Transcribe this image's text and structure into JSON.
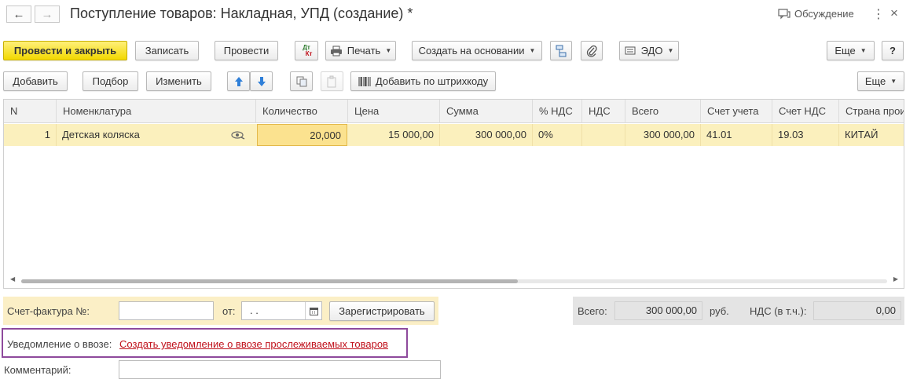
{
  "window": {
    "title": "Поступление товаров: Накладная, УПД (создание) *",
    "discussion_label": "Обсуждение"
  },
  "toolbar": {
    "post_and_close": "Провести и закрыть",
    "save": "Записать",
    "post": "Провести",
    "dt_kt_icon_text": "Дт Кт",
    "print": "Печать",
    "create_based_on": "Создать на основании",
    "edo": "ЭДО",
    "more": "Еще",
    "help": "?"
  },
  "table_toolbar": {
    "add": "Добавить",
    "pick": "Подбор",
    "edit": "Изменить",
    "add_by_barcode": "Добавить по штрихкоду",
    "more": "Еще"
  },
  "table": {
    "columns": [
      "N",
      "Номенклатура",
      "Количество",
      "Цена",
      "Сумма",
      "% НДС",
      "НДС",
      "Всего",
      "Счет учета",
      "Счет НДС",
      "Страна прои"
    ],
    "rows": [
      {
        "n": "1",
        "item": "Детская коляска",
        "quantity": "20,000",
        "price": "15 000,00",
        "sum": "300 000,00",
        "vat_rate": "0%",
        "vat": "",
        "total": "300 000,00",
        "account": "41.01",
        "vat_account": "19.03",
        "country": "КИТАЙ"
      }
    ]
  },
  "invoice": {
    "number_label": "Счет-фактура №:",
    "number_value": "",
    "date_label": "от:",
    "date_value": " .  .",
    "register_button": "Зарегистрировать"
  },
  "totals": {
    "total_label": "Всего:",
    "total_value": "300 000,00",
    "currency": "руб.",
    "vat_label": "НДС (в т.ч.):",
    "vat_value": "0,00"
  },
  "import_notice": {
    "label": "Уведомление о ввозе:",
    "link": "Создать уведомление о ввозе прослеживаемых товаров"
  },
  "comment": {
    "label": "Комментарий:",
    "value": ""
  },
  "colors": {
    "primary_button": "#f2d800",
    "row_highlight": "#fbf0bd",
    "link": "#c0121c",
    "notice_border": "#8e4a9c"
  }
}
